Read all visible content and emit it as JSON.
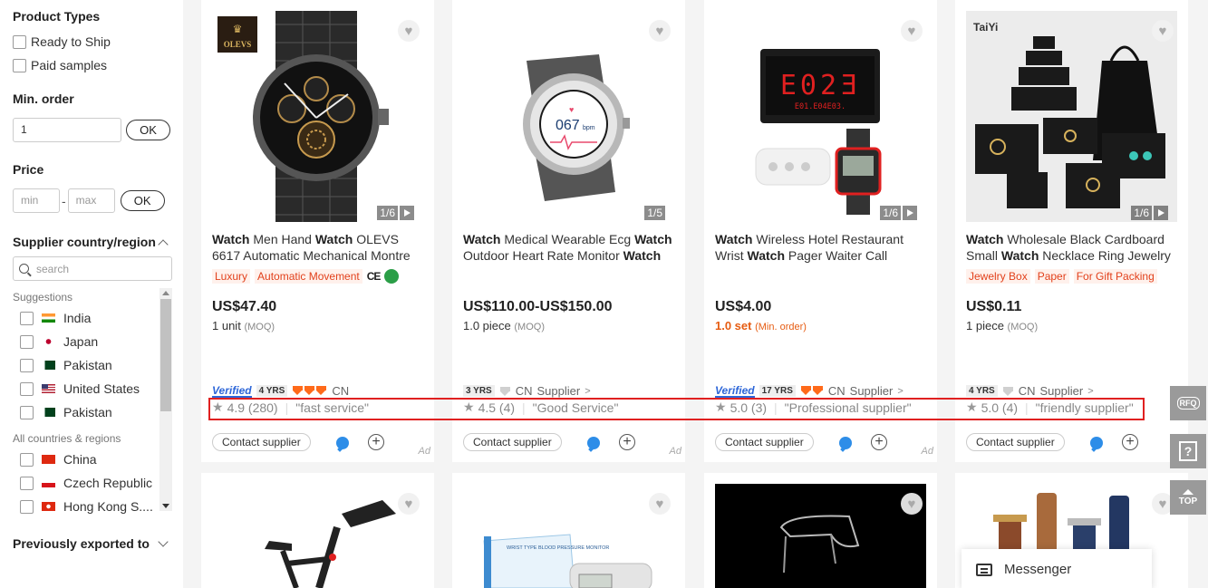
{
  "filters": {
    "product_types": {
      "title": "Product Types",
      "options": [
        "Ready to Ship",
        "Paid samples"
      ]
    },
    "min_order": {
      "title": "Min. order",
      "value": "1",
      "ok_label": "OK"
    },
    "price": {
      "title": "Price",
      "min_placeholder": "min",
      "max_placeholder": "max",
      "dash": "-",
      "ok_label": "OK"
    },
    "supplier_country": {
      "title": "Supplier country/region",
      "search_placeholder": "search",
      "suggestions_label": "Suggestions",
      "suggestions": [
        "India",
        "Japan",
        "Pakistan",
        "United States",
        "Pakistan"
      ],
      "all_label": "All countries & regions",
      "all": [
        "China",
        "Czech Republic",
        "Hong Kong S...."
      ]
    },
    "previously_exported": {
      "title": "Previously exported to"
    }
  },
  "products": [
    {
      "title_parts": [
        [
          "Watch",
          true
        ],
        [
          " Men Hand ",
          false
        ],
        [
          "Watch",
          true
        ],
        [
          " OLEVS 6617 Automatic Mechanical Montre",
          false
        ]
      ],
      "brand_label": "OLEVS",
      "tags": [
        "Luxury",
        "Automatic Movement"
      ],
      "cert": "CE",
      "img_count": "1/6",
      "price": "US$47.40",
      "moq": "1 unit",
      "moq_suffix": "(MOQ)",
      "verified": "Verified",
      "years": "4 YRS",
      "country": "CN",
      "rating": "4.9 (280)",
      "review": "\"fast service\"",
      "contact": "Contact supplier",
      "ad": "Ad"
    },
    {
      "title_parts": [
        [
          "Watch",
          true
        ],
        [
          " Medical Wearable Ecg ",
          false
        ],
        [
          "Watch",
          true
        ],
        [
          " Outdoor Heart Rate Monitor ",
          false
        ],
        [
          "Watch",
          true
        ]
      ],
      "screen_text": "067",
      "screen_unit": "bpm",
      "img_count": "1/5",
      "price": "US$110.00-US$150.00",
      "moq": "1.0 piece",
      "moq_suffix": "(MOQ)",
      "years": "3 YRS",
      "country": "CN",
      "supplier": "Supplier",
      "rating": "4.5 (4)",
      "review": "\"Good Service\"",
      "contact": "Contact supplier",
      "ad": "Ad"
    },
    {
      "title_parts": [
        [
          "Watch",
          true
        ],
        [
          " Wireless Hotel Restaurant Wrist ",
          false
        ],
        [
          "Watch",
          true
        ],
        [
          " Pager Waiter Call",
          false
        ]
      ],
      "display_main": "E02Ǝ",
      "display_sub": "E01.E04E03.",
      "img_count": "1/6",
      "price": "US$4.00",
      "moq": "1.0 set",
      "moq_suffix": "(Min. order)",
      "verified": "Verified",
      "years": "17 YRS",
      "country": "CN",
      "supplier": "Supplier",
      "rating": "5.0 (3)",
      "review": "\"Professional supplier\"",
      "contact": "Contact supplier",
      "ad": "Ad"
    },
    {
      "title_parts": [
        [
          "Watch",
          true
        ],
        [
          " Wholesale Black Cardboard Small ",
          false
        ],
        [
          "Watch",
          true
        ],
        [
          " Necklace Ring Jewelry",
          false
        ]
      ],
      "brand_label": "TaiYi",
      "tags": [
        "Jewelry Box",
        "Paper",
        "For Gift Packing"
      ],
      "img_count": "1/6",
      "price": "US$0.11",
      "moq": "1 piece",
      "moq_suffix": "(MOQ)",
      "years": "4 YRS",
      "country": "CN",
      "supplier": "Supplier",
      "rating": "5.0 (4)",
      "review": "\"friendly supplier\"",
      "contact": "Contact supplier"
    }
  ],
  "bottom_product_images": {
    "blood_pressure_text": "WRIST TYPE BLOOD PRESSURE MONITOR"
  },
  "side_buttons": {
    "rfq": "RFQ",
    "help": "?",
    "top": "TOP"
  },
  "messenger": {
    "label": "Messenger"
  },
  "colors": {
    "accent_orange": "#ff6a1a",
    "tag_red": "#e2411c",
    "verified_blue": "#2d66d8",
    "highlight_red": "#e02020"
  }
}
